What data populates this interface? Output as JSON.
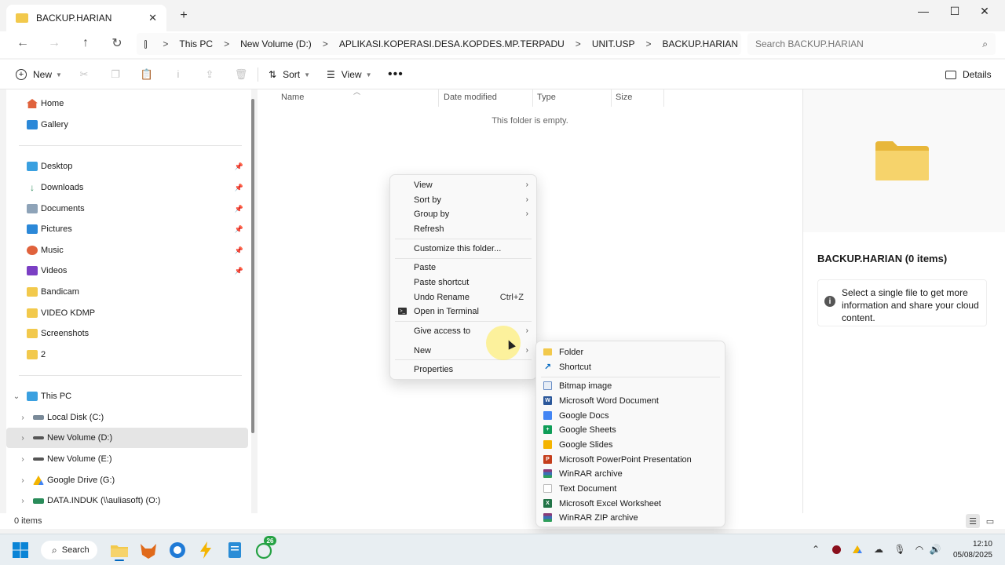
{
  "window": {
    "tab_title": "BACKUP.HARIAN",
    "colors": {
      "accent": "#0067c0",
      "folder": "#f2c94c",
      "selected_bg": "#e5e5e5"
    }
  },
  "address": {
    "crumbs": [
      "This PC",
      "New Volume (D:)",
      "APLIKASI.KOPERASI.DESA.KOPDES.MP.TERPADU",
      "UNIT.USP",
      "BACKUP.HARIAN"
    ]
  },
  "search": {
    "placeholder": "Search BACKUP.HARIAN"
  },
  "toolbar": {
    "new_label": "New",
    "sort_label": "Sort",
    "view_label": "View",
    "details_label": "Details"
  },
  "sidebar": {
    "top": [
      {
        "label": "Home",
        "icon": "home-icon"
      },
      {
        "label": "Gallery",
        "icon": "gallery-icon"
      }
    ],
    "quick_access": [
      {
        "label": "Desktop",
        "pinned": true
      },
      {
        "label": "Downloads",
        "pinned": true
      },
      {
        "label": "Documents",
        "pinned": true
      },
      {
        "label": "Pictures",
        "pinned": true
      },
      {
        "label": "Music",
        "pinned": true
      },
      {
        "label": "Videos",
        "pinned": true
      },
      {
        "label": "Bandicam",
        "pinned": false
      },
      {
        "label": "VIDEO KDMP",
        "pinned": false
      },
      {
        "label": "Screenshots",
        "pinned": false
      },
      {
        "label": "2",
        "pinned": false
      }
    ],
    "this_pc_label": "This PC",
    "drives": [
      {
        "label": "Local Disk (C:)",
        "selected": false
      },
      {
        "label": "New Volume (D:)",
        "selected": true
      },
      {
        "label": "New Volume (E:)",
        "selected": false
      },
      {
        "label": "Google Drive (G:)",
        "selected": false
      },
      {
        "label": "DATA.INDUK (\\\\auliasoft) (O:)",
        "selected": false
      }
    ]
  },
  "columns": [
    "Name",
    "Date modified",
    "Type",
    "Size"
  ],
  "empty_message": "This folder is empty.",
  "context_menu": {
    "items": [
      {
        "label": "View",
        "submenu": true
      },
      {
        "label": "Sort by",
        "submenu": true
      },
      {
        "label": "Group by",
        "submenu": true
      },
      {
        "label": "Refresh"
      },
      {
        "label": "Customize this folder..."
      },
      {
        "label": "Paste"
      },
      {
        "label": "Paste shortcut"
      },
      {
        "label": "Undo Rename",
        "shortcut": "Ctrl+Z"
      },
      {
        "label": "Open in Terminal",
        "icon": "terminal-icon"
      },
      {
        "label": "Give access to",
        "submenu": true
      },
      {
        "label": "New",
        "submenu": true
      },
      {
        "label": "Properties"
      }
    ]
  },
  "new_submenu": {
    "items": [
      {
        "label": "Folder",
        "icon": "folder-icon",
        "color": "#f2c94c"
      },
      {
        "label": "Shortcut",
        "icon": "shortcut-icon",
        "color": "#0067c0"
      },
      {
        "label": "Bitmap image",
        "icon": "bitmap-icon",
        "color": "#6b8fc7"
      },
      {
        "label": "Microsoft Word Document",
        "icon": "word-icon",
        "color": "#2b579a"
      },
      {
        "label": "Google Docs",
        "icon": "google-docs-icon",
        "color": "#4285f4"
      },
      {
        "label": "Google Sheets",
        "icon": "google-sheets-icon",
        "color": "#0f9d58"
      },
      {
        "label": "Google Slides",
        "icon": "google-slides-icon",
        "color": "#f4b400"
      },
      {
        "label": "Microsoft PowerPoint Presentation",
        "icon": "powerpoint-icon",
        "color": "#c43e1c"
      },
      {
        "label": "WinRAR archive",
        "icon": "winrar-icon",
        "color": "#8a3b78"
      },
      {
        "label": "Text Document",
        "icon": "text-document-icon",
        "color": "#cfcfcf"
      },
      {
        "label": "Microsoft Excel Worksheet",
        "icon": "excel-icon",
        "color": "#217346"
      },
      {
        "label": "WinRAR ZIP archive",
        "icon": "winrar-zip-icon",
        "color": "#8a3b78"
      }
    ]
  },
  "details_pane": {
    "title": "BACKUP.HARIAN (0 items)",
    "info": "Select a single file to get more information and share your cloud content."
  },
  "status": {
    "count": "0 items"
  },
  "taskbar": {
    "search_label": "Search",
    "whatsapp_badge": "26",
    "time": "12:10",
    "date": "05/08/2025"
  }
}
